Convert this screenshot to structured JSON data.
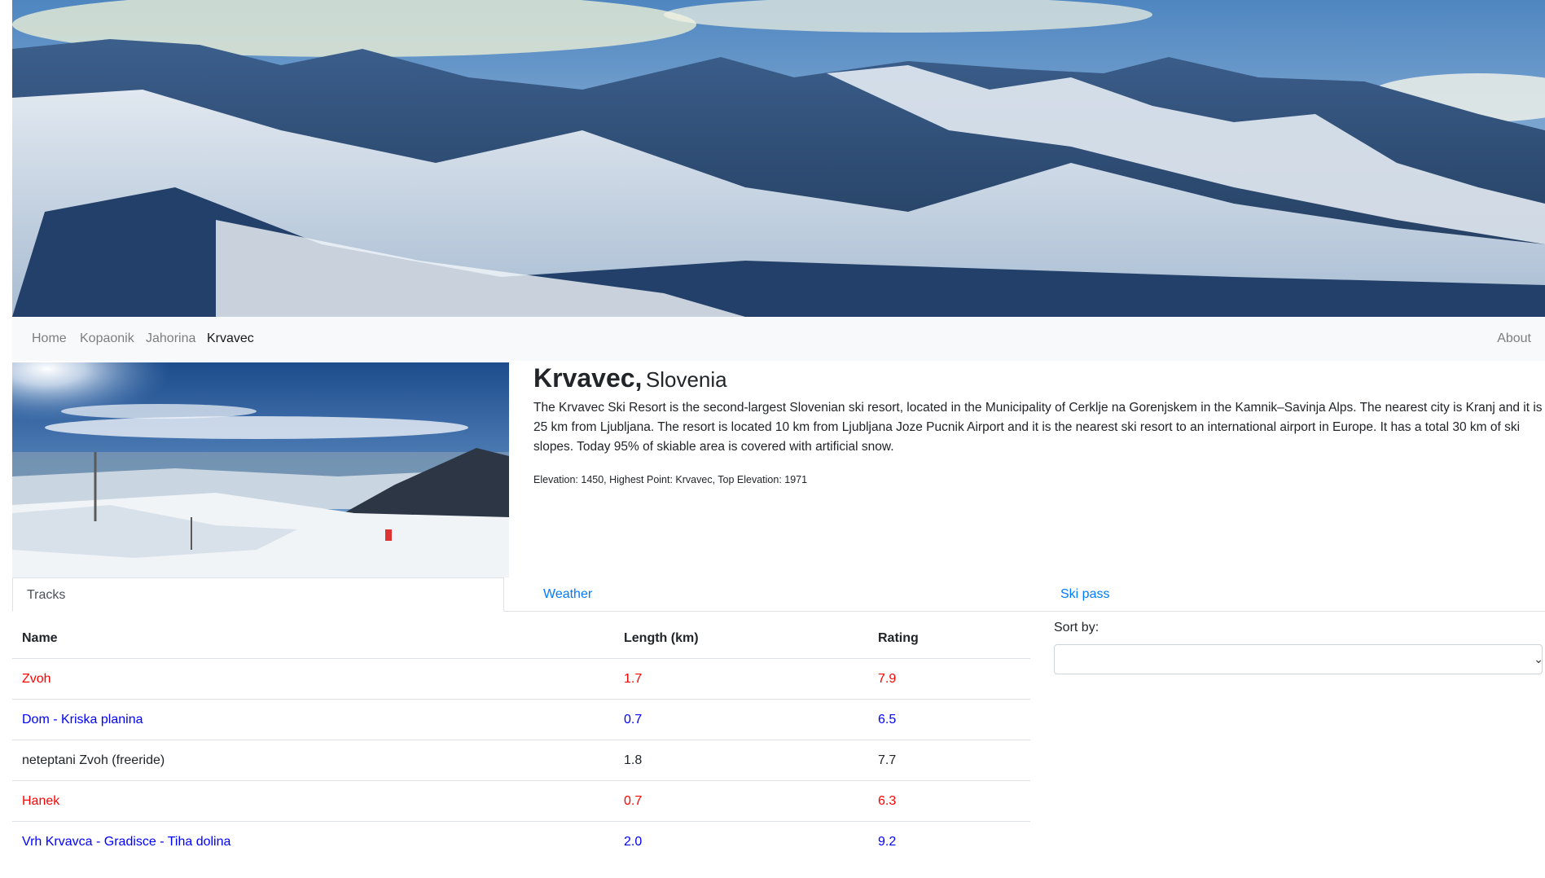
{
  "nav": {
    "items": [
      {
        "label": "Home",
        "active": false
      },
      {
        "label": "Kopaonik",
        "active": false
      },
      {
        "label": "Jahorina",
        "active": false
      },
      {
        "label": "Krvavec",
        "active": true
      }
    ],
    "about": "About"
  },
  "resort": {
    "name": "Krvavec,",
    "country": "Slovenia",
    "description": "The Krvavec Ski Resort is the second-largest Slovenian ski resort, located in the Municipality of Cerklje na Gorenjskem in the Kamnik–Savinja Alps. The nearest city is Kranj and it is 25 km from Ljubljana. The resort is located 10 km from Ljubljana Joze Pucnik Airport and it is the nearest ski resort to an international airport in Europe. It has a total 30 km of ski slopes. Today 95% of skiable area is covered with artificial snow.",
    "stats": "Elevation: 1450, Highest Point: Krvavec, Top Elevation: 1971"
  },
  "tabs": {
    "tracks": "Tracks",
    "weather": "Weather",
    "skipass": "Ski pass"
  },
  "table": {
    "headers": {
      "name": "Name",
      "length": "Length (km)",
      "rating": "Rating"
    },
    "rows": [
      {
        "name": "Zvoh",
        "length": "1.7",
        "rating": "7.9",
        "color": "#ff0000"
      },
      {
        "name": "Dom - Kriska planina",
        "length": "0.7",
        "rating": "6.5",
        "color": "#0000ff"
      },
      {
        "name": "neteptani Zvoh (freeride)",
        "length": "1.8",
        "rating": "7.7",
        "color": "#212529"
      },
      {
        "name": "Hanek",
        "length": "0.7",
        "rating": "6.3",
        "color": "#ff0000"
      },
      {
        "name": "Vrh Krvavca - Gradisce - Tiha dolina",
        "length": "2.0",
        "rating": "9.2",
        "color": "#0000ff"
      }
    ]
  },
  "sort": {
    "label": "Sort by:",
    "value": ""
  },
  "colors": {
    "link": "#007bff",
    "difficulty_red": "#ff0000",
    "difficulty_blue": "#0000ff",
    "difficulty_black": "#212529"
  }
}
